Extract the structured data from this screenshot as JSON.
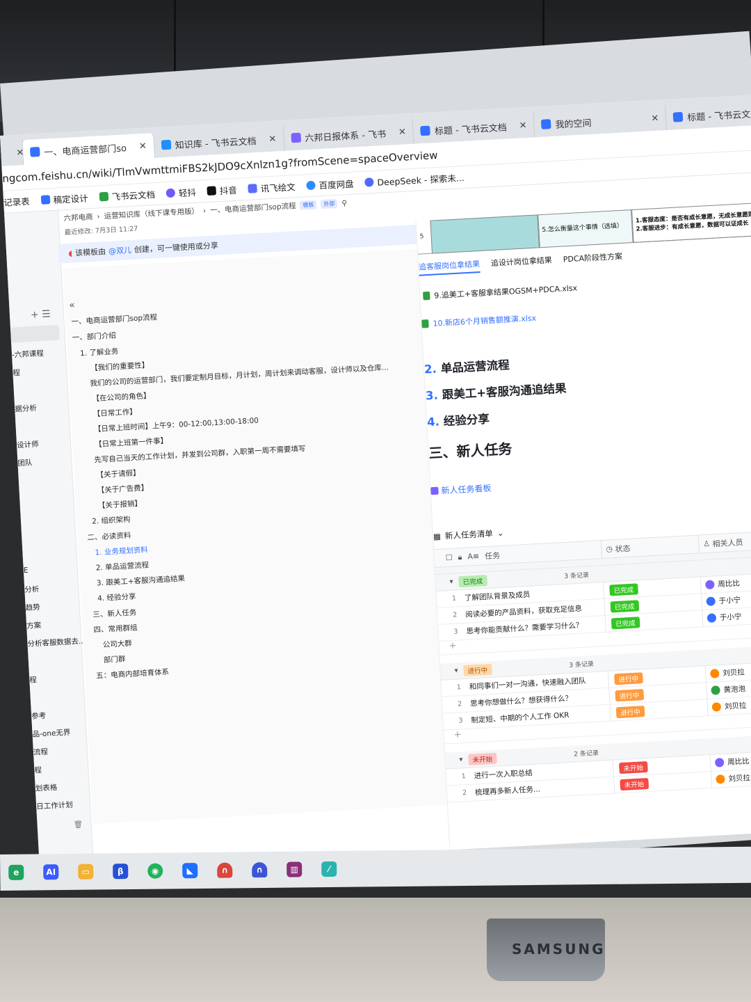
{
  "browser": {
    "tabs": [
      {
        "label": "一、电商运营部门so",
        "active": true
      },
      {
        "label": "知识库 - 飞书云文档",
        "active": false
      },
      {
        "label": "六邦日报体系 - 飞书",
        "active": false
      },
      {
        "label": "标题 - 飞书云文档",
        "active": false
      },
      {
        "label": "我的空间",
        "active": false
      },
      {
        "label": "标题 - 飞书云文",
        "active": false
      }
    ],
    "url": "ngcom.feishu.cn/wiki/TlmVwmttmiFBS2kJDO9cXnlzn1g?fromScene=spaceOverview",
    "bookmarks": [
      "记录表",
      "稿定设计",
      "飞书云文档",
      "轻抖",
      "抖音",
      "讯飞绘文",
      "百度网盘",
      "DeepSeek - 探索未..."
    ]
  },
  "doc_header": {
    "crumbs": [
      "六邦电商",
      "运营知识库（线下课专用版）",
      "一、电商运营部门sop流程"
    ],
    "tags": [
      "模板",
      "外部"
    ],
    "last_edited": "最近修改: 7月3日 11:27",
    "template_note_prefix": "该模板由",
    "template_note_user": "@双儿",
    "template_note_suffix": "创建，可一键使用或分享"
  },
  "left_sidebar": {
    "items": [
      "-六邦课程",
      "程",
      "据分析",
      "设计师",
      "团队",
      "E",
      "分析",
      "趋势",
      "方案",
      "分析客服数据去...",
      "程",
      "参考",
      "品-one无界",
      "流程",
      "程",
      "划表格",
      "日工作计划"
    ]
  },
  "outline": {
    "collapse": "«",
    "items": [
      {
        "text": "一、电商运营部门sop流程",
        "link": false
      },
      {
        "text": "一、部门介绍",
        "link": false
      },
      {
        "text": "1. 了解业务",
        "link": false
      },
      {
        "text": "【我们的重要性】",
        "link": false
      },
      {
        "text": "我们的公司的运营部门，我们要定制月目标，月计划，周计划来调动客服，设计师以及仓库...",
        "link": false
      },
      {
        "text": "【在公司的角色】",
        "link": false
      },
      {
        "text": "【日常工作】",
        "link": false
      },
      {
        "text": "【日常上班时间】上午9：00-12:00,13:00-18:00",
        "link": false
      },
      {
        "text": "【日常上班第一件事】",
        "link": false
      },
      {
        "text": "先写自己当天的工作计划，并发到公司群，入职第一周不需要填写",
        "link": false
      },
      {
        "text": "【关于请假】",
        "link": false
      },
      {
        "text": "【关于广告费】",
        "link": false
      },
      {
        "text": "【关于报销】",
        "link": false
      },
      {
        "text": "2. 组织架构",
        "link": false
      },
      {
        "text": "二、必读资料",
        "link": false
      },
      {
        "text": "1. 业务规划资料",
        "link": true
      },
      {
        "text": "2. 单品运营流程",
        "link": false
      },
      {
        "text": "3. 跟美工+客服沟通追结果",
        "link": false
      },
      {
        "text": "4. 经验分享",
        "link": false
      },
      {
        "text": "三、新人任务",
        "link": false
      },
      {
        "text": "四、常用群组",
        "link": false
      },
      {
        "text": "公司大群",
        "link": false
      },
      {
        "text": "部门群",
        "link": false
      },
      {
        "text": "五：电商内部培育体系",
        "link": false
      }
    ]
  },
  "content": {
    "table_fragment": {
      "row_no": "5",
      "question": "5.怎么衡量这个事情（选填）",
      "answer_line1": "1.客服态度：是否有成长意愿，无成长意愿则",
      "answer_line2": "2.客服进步：有成长意愿，数据可以证成长"
    },
    "sheet_tabs": [
      "追客服岗位拿结果",
      "追设计岗位拿结果",
      "PDCA阶段性方案"
    ],
    "files": [
      "9.追美工+客服拿结果OGSM+PDCA.xlsx",
      "10.新店6个月销售额推演.xlsx"
    ],
    "headings": [
      {
        "num": "2.",
        "text": "单品运营流程"
      },
      {
        "num": "3.",
        "text": "跟美工+客服沟通追结果"
      },
      {
        "num": "4.",
        "text": "经验分享"
      }
    ],
    "section_title": "三、新人任务",
    "board_link": "新人任务看板",
    "bitable": {
      "title": "新人任务清单",
      "columns": [
        "任务",
        "状态",
        "相关人员"
      ],
      "groups": [
        {
          "status": "已完成",
          "kind": "done",
          "count": "3 条记录",
          "rows": [
            {
              "idx": "1",
              "task": "了解团队背景及成员",
              "status": "已完成",
              "person": "周比比",
              "color": "#7b61ff"
            },
            {
              "idx": "2",
              "task": "阅读必要的产品资料，获取充足信息",
              "status": "已完成",
              "person": "于小宁",
              "color": "#3370ff"
            },
            {
              "idx": "3",
              "task": "思考你能贡献什么？需要学习什么？",
              "status": "已完成",
              "person": "于小宁",
              "color": "#3370ff"
            }
          ]
        },
        {
          "status": "进行中",
          "kind": "doing",
          "count": "3 条记录",
          "rows": [
            {
              "idx": "1",
              "task": "和同事们一对一沟通，快速融入团队",
              "status": "进行中",
              "person": "刘贝拉",
              "color": "#ff8800"
            },
            {
              "idx": "2",
              "task": "思考你想做什么？想获得什么？",
              "status": "进行中",
              "person": "黄泡泡",
              "color": "#2ea043"
            },
            {
              "idx": "3",
              "task": "制定短、中期的个人工作 OKR",
              "status": "进行中",
              "person": "刘贝拉",
              "color": "#ff8800"
            }
          ]
        },
        {
          "status": "未开始",
          "kind": "todo",
          "count": "2 条记录",
          "rows": [
            {
              "idx": "1",
              "task": "进行一次入职总结",
              "status": "未开始",
              "person": "周比比",
              "color": "#7b61ff"
            },
            {
              "idx": "2",
              "task": "梳理再多新人任务...",
              "status": "未开始",
              "person": "刘贝拉",
              "color": "#ff8800"
            }
          ]
        }
      ]
    }
  },
  "monitor_brand": "SAMSUNG",
  "taskbar_icons": [
    "edge-icon",
    "ai-icon",
    "file-explorer-icon",
    "shield-app-icon",
    "wechat-icon",
    "feishu-icon",
    "headset-icon",
    "headset-icon-2",
    "winrar-icon",
    "chart-app-icon"
  ]
}
